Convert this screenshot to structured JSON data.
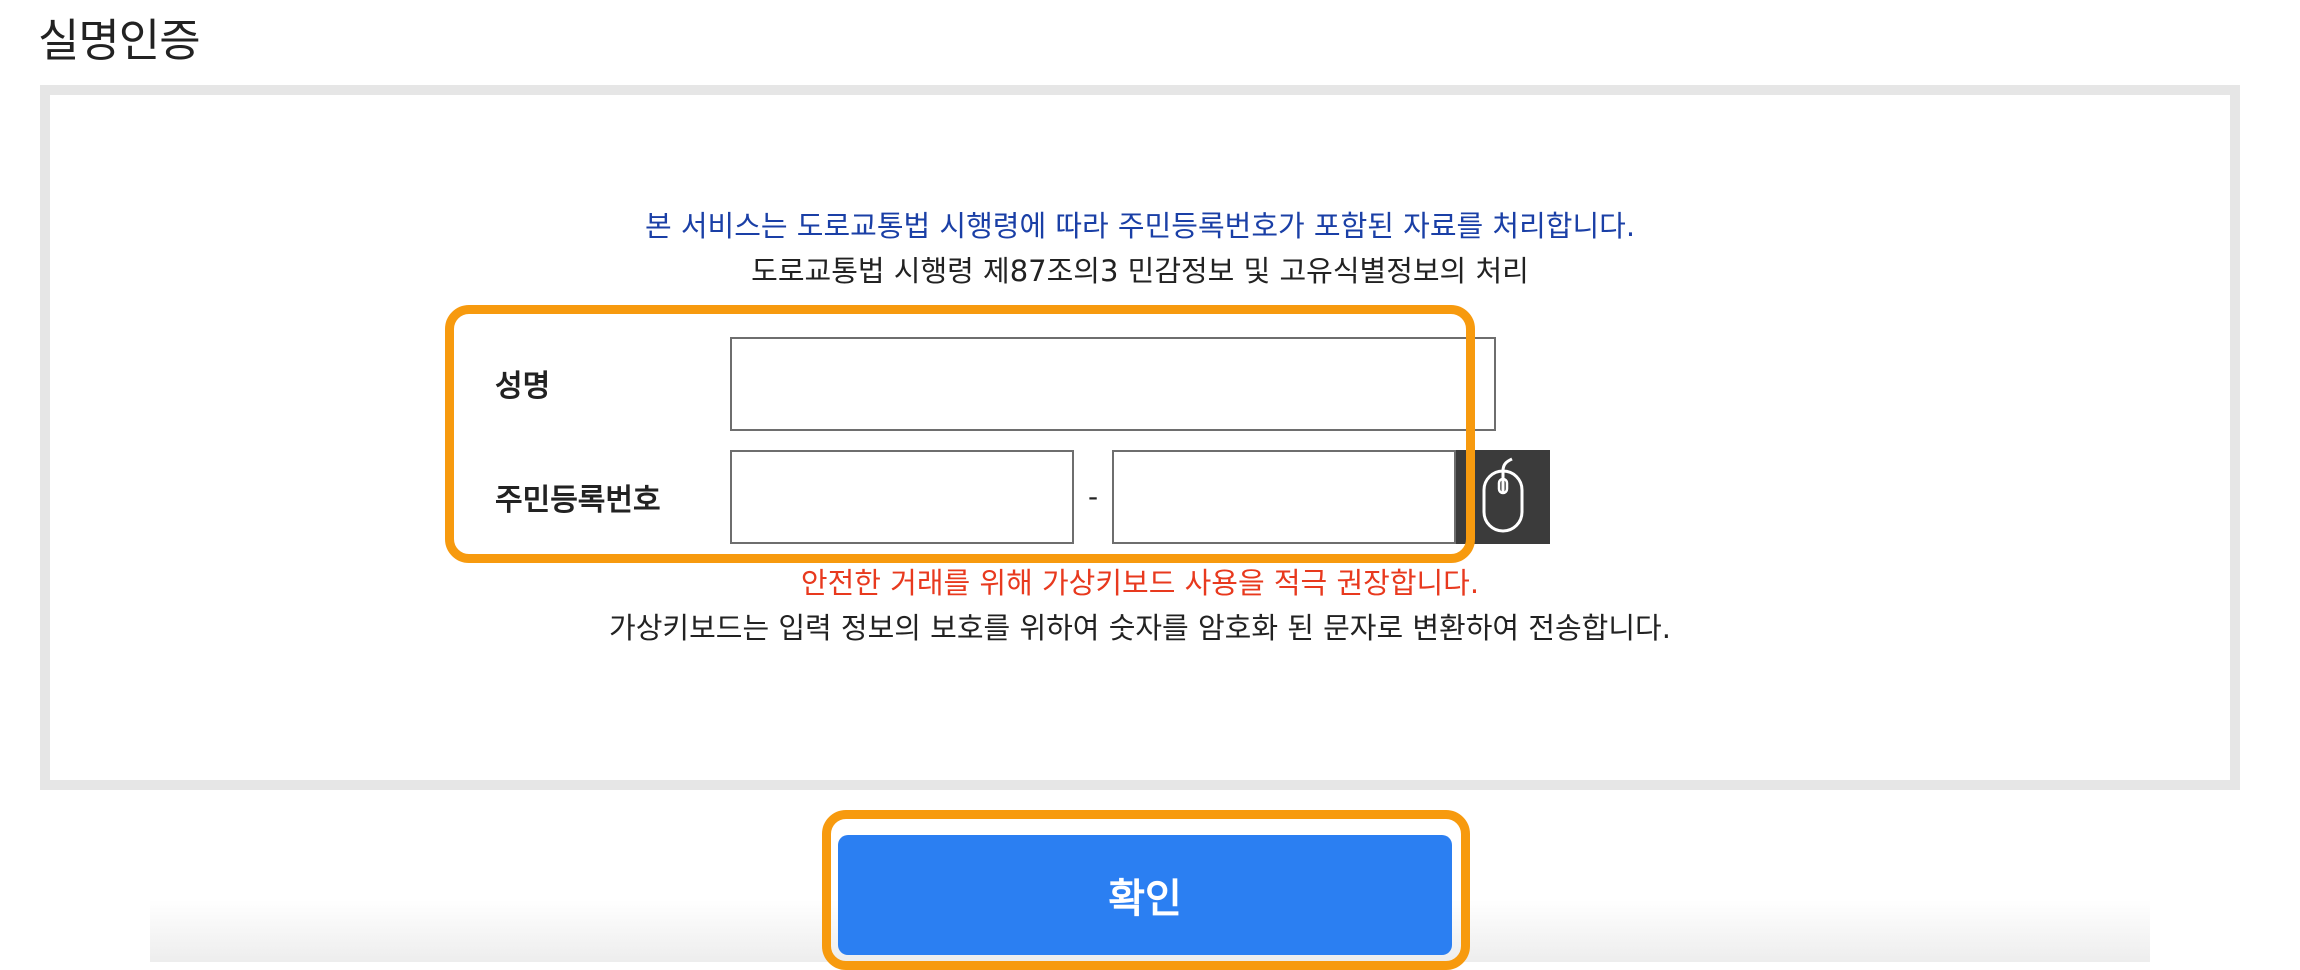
{
  "page": {
    "title": "실명인증"
  },
  "notice": {
    "privacy_statement": "본 서비스는 도로교통법 시행령에 따라 주민등록번호가 포함된 자료를 처리합니다.",
    "law_reference": "도로교통법 시행령 제87조의3 민감정보 및 고유식별정보의 처리"
  },
  "form": {
    "name_label": "성명",
    "name_value": "",
    "rrn_label": "주민등록번호",
    "rrn_front_value": "",
    "rrn_separator": "-",
    "rrn_back_value": ""
  },
  "virtual_keyboard": {
    "icon": "mouse-icon",
    "warning": "안전한 거래를 위해 가상키보드 사용을 적극 권장합니다.",
    "description": "가상키보드는 입력 정보의 보호를 위하여 숫자를 암호화 된 문자로 변환하여 전송합니다."
  },
  "actions": {
    "confirm_label": "확인"
  },
  "colors": {
    "notice_blue": "#1a3fa6",
    "warning_red": "#e8391e",
    "confirm_blue": "#2b7ff2",
    "highlight_orange": "#f79a0e",
    "box_border": "#e6e6e6"
  }
}
